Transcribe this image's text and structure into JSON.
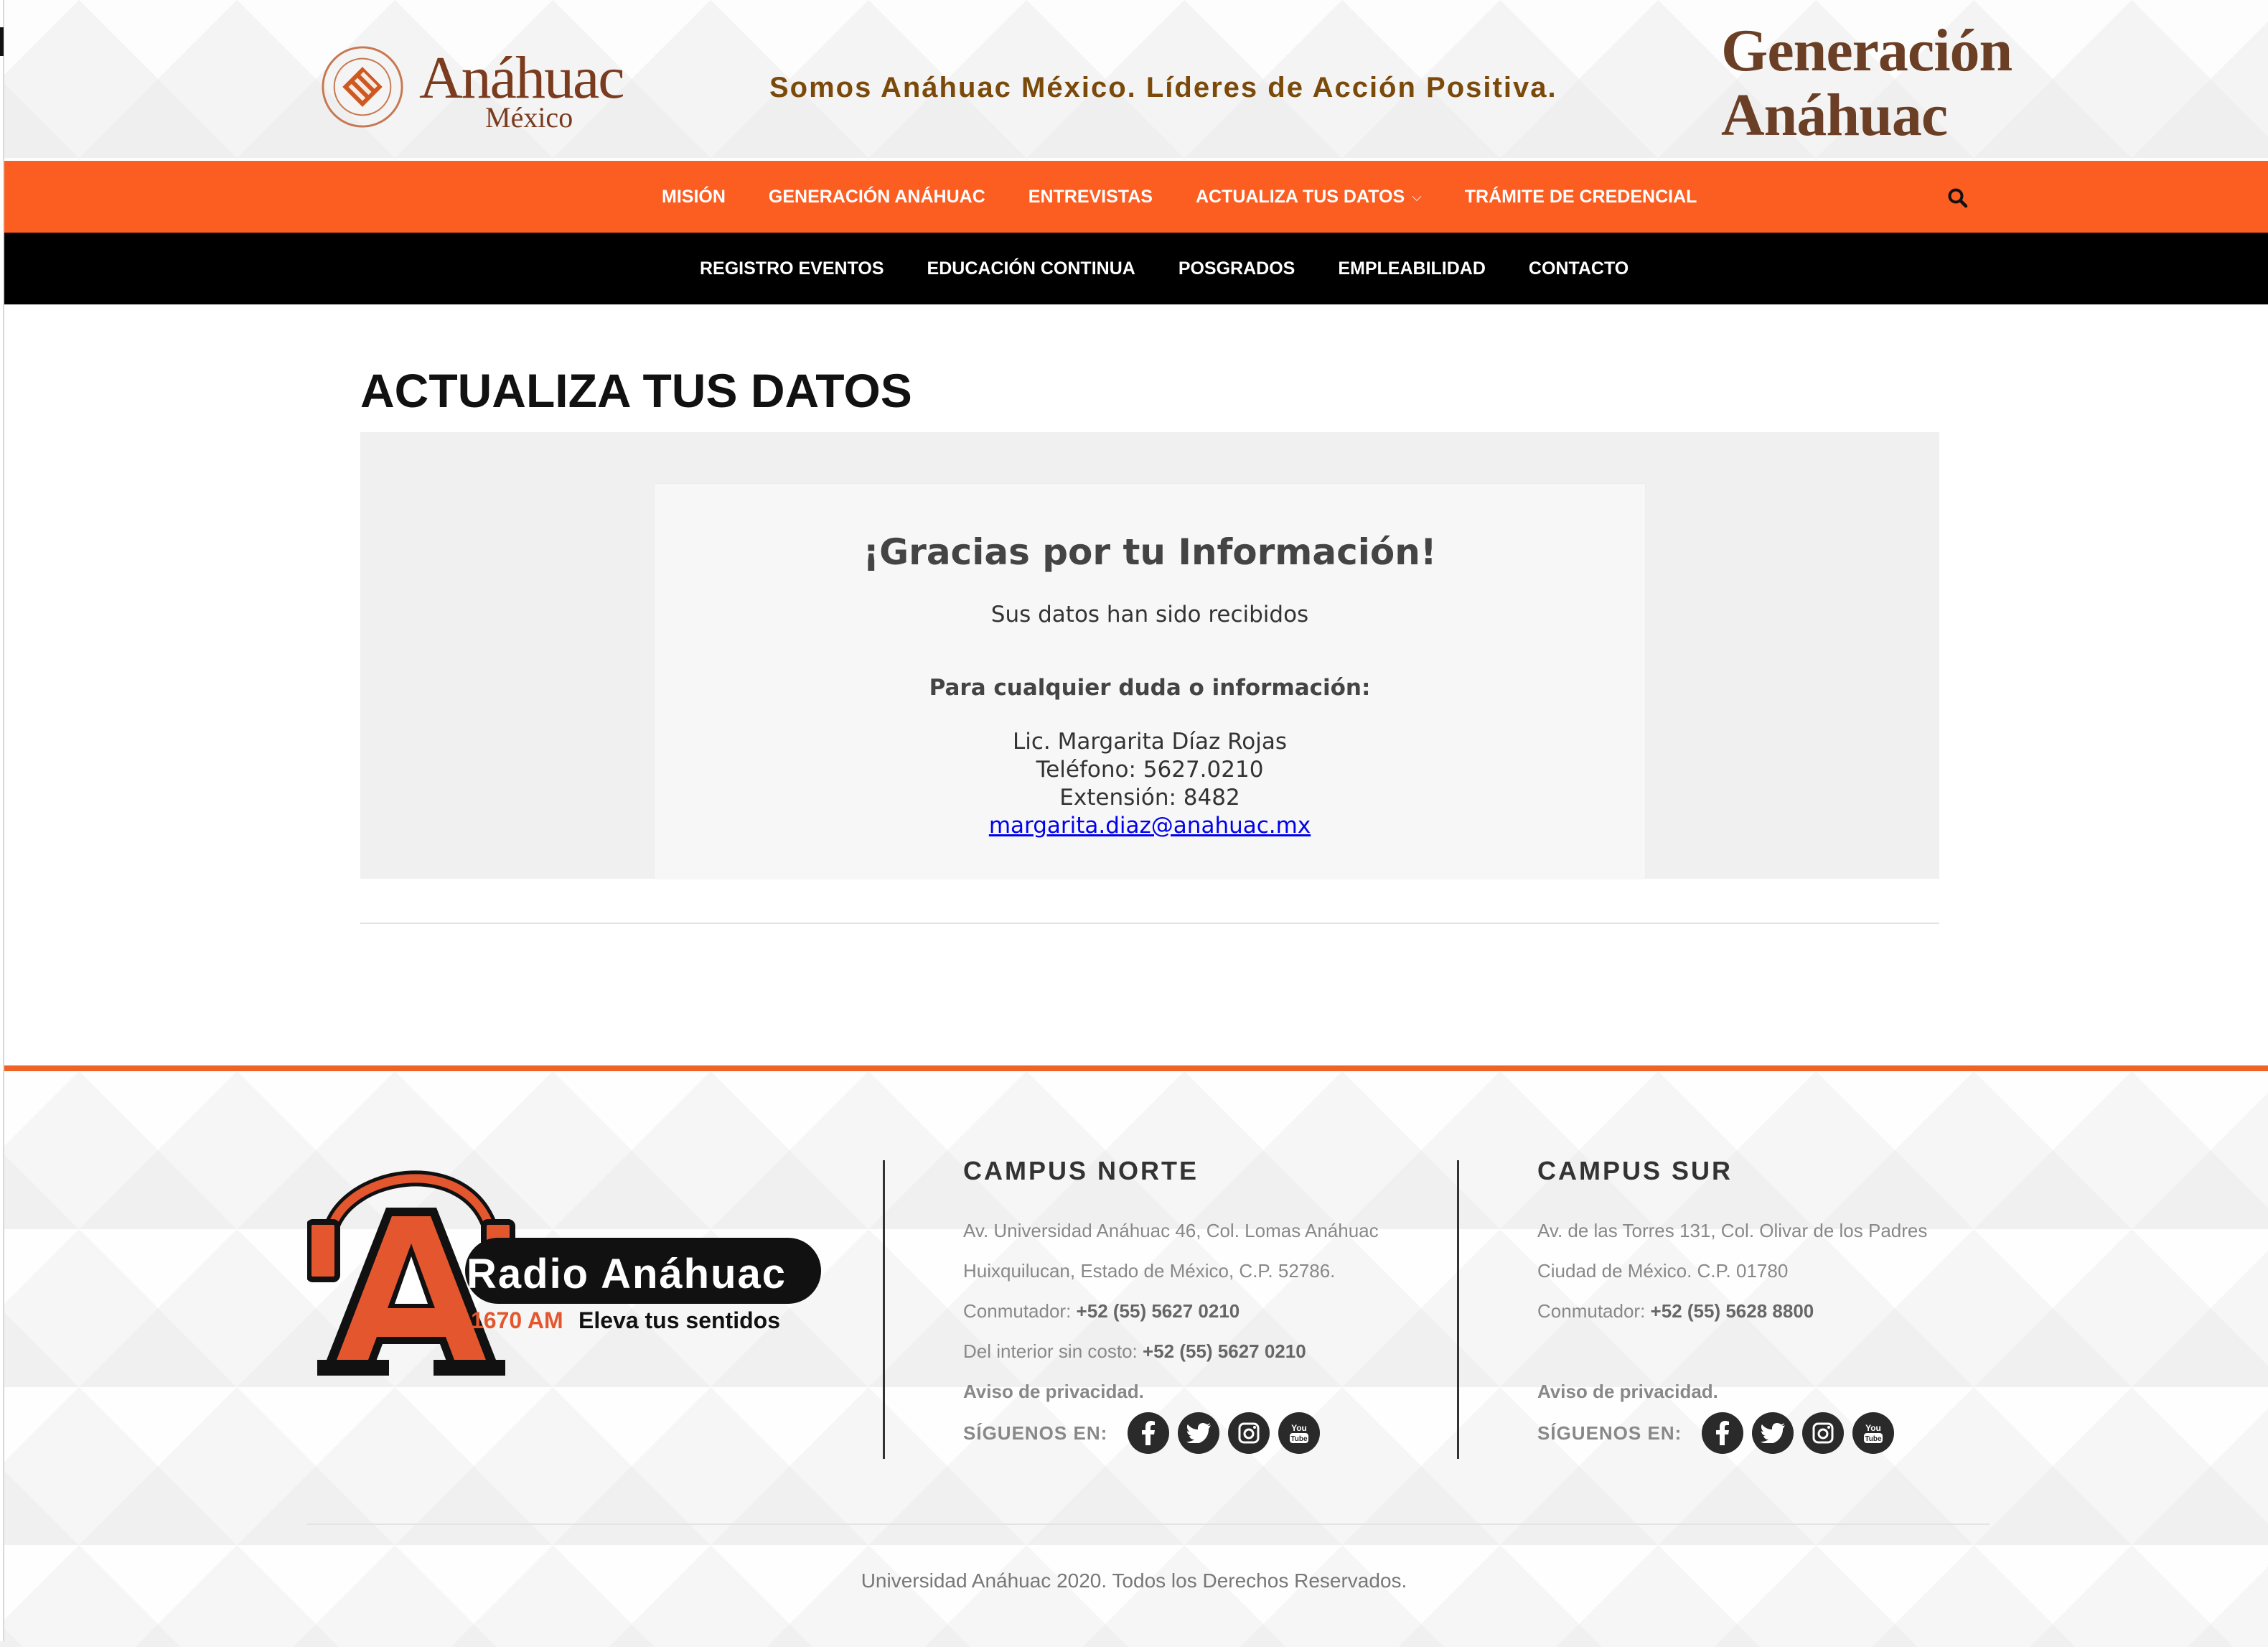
{
  "header": {
    "logo_name": "Anáhuac",
    "logo_sub": "México",
    "tagline": "Somos Anáhuac México. Líderes de Acción Positiva.",
    "generation_line1": "Generación",
    "generation_line2": "Anáhuac"
  },
  "nav_primary": [
    {
      "label": "MISIÓN"
    },
    {
      "label": "GENERACIÓN ANÁHUAC"
    },
    {
      "label": "ENTREVISTAS"
    },
    {
      "label": "ACTUALIZA TUS DATOS",
      "dropdown": true
    },
    {
      "label": "TRÁMITE DE CREDENCIAL"
    }
  ],
  "nav_secondary": [
    {
      "label": "REGISTRO EVENTOS"
    },
    {
      "label": "EDUCACIÓN CONTINUA"
    },
    {
      "label": "POSGRADOS"
    },
    {
      "label": "EMPLEABILIDAD"
    },
    {
      "label": "CONTACTO"
    }
  ],
  "page": {
    "title": "ACTUALIZA TUS DATOS",
    "thanks": "¡Gracias por tu Información!",
    "received": "Sus datos han sido recibidos",
    "doubt": "Para cualquier duda o información:",
    "contact_name": "Lic. Margarita Díaz Rojas",
    "contact_phone": "Teléfono: 5627.0210",
    "contact_ext": "Extensión: 8482",
    "contact_email": "margarita.diaz@anahuac.mx"
  },
  "footer": {
    "radio": {
      "name": "Radio Anáhuac",
      "freq": "1670 AM",
      "slogan": "Eleva tus sentidos"
    },
    "campus_norte": {
      "title": "CAMPUS NORTE",
      "address1": "Av. Universidad Anáhuac 46, Col. Lomas Anáhuac",
      "address2": "Huixquilucan, Estado de México, C.P. 52786.",
      "phone_label": "Conmutador:",
      "phone": "+52 (55) 5627 0210",
      "tollfree_label": "Del interior sin costo:",
      "tollfree": "+52 (55) 5627 0210",
      "privacy": "Aviso de privacidad.",
      "follow": "SÍGUENOS EN:"
    },
    "campus_sur": {
      "title": "CAMPUS SUR",
      "address1": "Av. de las Torres 131, Col. Olivar de los Padres",
      "address2": "Ciudad de México. C.P. 01780",
      "phone_label": "Conmutador:",
      "phone": "+52 (55) 5628 8800",
      "privacy": "Aviso de privacidad.",
      "follow": "SÍGUENOS EN:"
    },
    "copyright": "Universidad Anáhuac 2020. Todos los Derechos Reservados."
  },
  "icons": [
    "search-icon",
    "facebook-icon",
    "twitter-icon",
    "instagram-icon",
    "youtube-icon"
  ],
  "colors": {
    "accent_orange": "#fc5d21",
    "nav_black": "#000000",
    "brand_brown": "#7a3b1e"
  }
}
